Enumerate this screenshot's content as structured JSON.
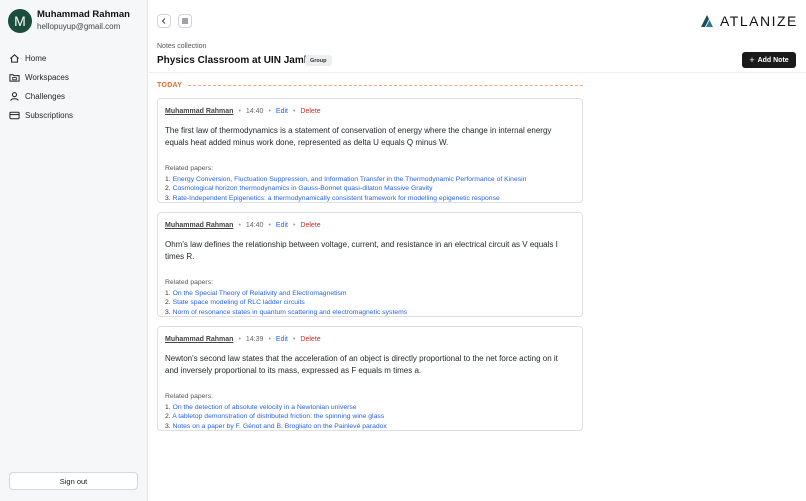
{
  "user": {
    "initial": "M",
    "name": "Muhammad Rahman",
    "email": "hellopuyup@gmail.com"
  },
  "nav": [
    {
      "label": "Home",
      "icon": "home-icon"
    },
    {
      "label": "Workspaces",
      "icon": "folder-icon"
    },
    {
      "label": "Challenges",
      "icon": "user-icon"
    },
    {
      "label": "Subscriptions",
      "icon": "credit-card-icon"
    }
  ],
  "sign_out": "Sign out",
  "brand": {
    "name": "ATLANIZE",
    "icon": "atlanize-logo-icon"
  },
  "header": {
    "collection_label": "Notes collection",
    "title": "Physics Classroom at UIN Jambi",
    "badge": "Group",
    "add_note": "Add Note"
  },
  "section_label": "TODAY",
  "actions": {
    "edit": "Edit",
    "delete": "Delete"
  },
  "related_label": "Related papers:",
  "notes": [
    {
      "author": "Muhammad Rahman",
      "time": "14:40",
      "body": "The first law of thermodynamics is a statement of conservation of energy where the change in internal energy equals heat added minus work done, represented as delta U equals Q minus W.",
      "papers": [
        "Energy Conversion, Fluctuation Suppression, and Information Transfer in the Thermodynamic Performance of Kinesin",
        "Cosmological horizon thermodynamics in Gauss-Bonnet quasi-dilaton Massive Gravity",
        "Rate-Independent Epigenetics: a thermodynamically consistent framework for modelling epigenetic response"
      ]
    },
    {
      "author": "Muhammad Rahman",
      "time": "14:40",
      "body": "Ohm's law defines the relationship between voltage, current, and resistance in an electrical circuit as V equals I times R.",
      "papers": [
        "On the Special Theory of Relativity and Electromagnetism",
        "State space modeling of RLC ladder circuits",
        "Norm of resonance states in quantum scattering and electromagnetic systems"
      ]
    },
    {
      "author": "Muhammad Rahman",
      "time": "14:39",
      "body": "Newton's second law states that the acceleration of an object is directly proportional to the net force acting on it and inversely proportional to its mass, expressed as F equals m times a.",
      "papers": [
        "On the detection of absolute velocity in a Newtonian universe",
        "A tabletop demonstration of distributed friction: the spinning wine glass",
        "Notes on a paper by F. Génot and B. Brogliato on the Painlevé paradox"
      ]
    }
  ]
}
